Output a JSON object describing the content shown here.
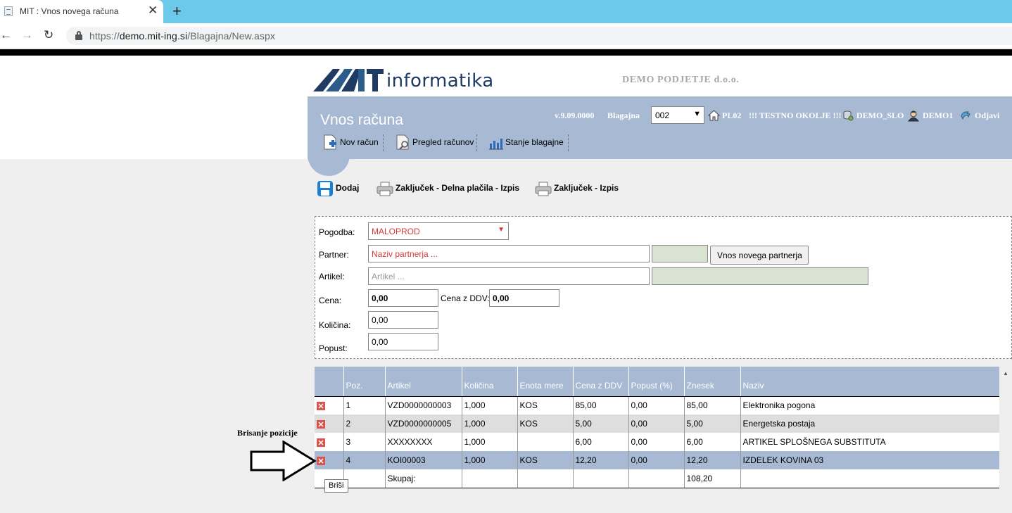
{
  "browser": {
    "tab_title": "MIT : Vnos novega računa",
    "close_glyph": "✕",
    "newtab_glyph": "+",
    "url_scheme": "https://",
    "url_host": "demo.mit-ing.si",
    "url_path": "/Blagajna/New.aspx"
  },
  "header": {
    "logo_text": "informatika",
    "company": "DEMO PODJETJE d.o.o.",
    "page_title": "Vnos računa",
    "version": "v.9.09.0000",
    "blagajna_label": "Blagajna",
    "blagajna_value": "002",
    "location": "PL02",
    "environment": "!!! TESTNO OKOLJE !!!",
    "database": "DEMO_SLO",
    "user": "DEMO1",
    "logout": "Odjavi"
  },
  "menu": {
    "new_invoice": "Nov račun",
    "invoice_list": "Pregled računov",
    "cash_state": "Stanje blagajne"
  },
  "toolbar": {
    "add": "Dodaj",
    "close_partial": "Zaključek - Delna plačila - Izpis",
    "close_print": "Zaključek - Izpis"
  },
  "form": {
    "contract_label": "Pogodba:",
    "contract_value": "MALOPROD",
    "partner_label": "Partner:",
    "partner_placeholder": "Naziv partnerja ...",
    "new_partner_button": "Vnos novega partnerja",
    "item_label": "Artikel:",
    "item_placeholder": "Artikel ...",
    "price_label": "Cena:",
    "price_value": "0,00",
    "price_vat_label": "Cena z DDV:",
    "price_vat_value": "0,00",
    "qty_label": "Količina:",
    "qty_value": "0,00",
    "discount_label": "Popust:",
    "discount_value": "0,00"
  },
  "grid": {
    "headers": [
      "",
      "Poz.",
      "Artikel",
      "Količina",
      "Enota mere",
      "Cena z DDV",
      "Popust (%)",
      "Znesek",
      "Naziv"
    ],
    "rows": [
      {
        "pos": "1",
        "item": "VZD0000000003",
        "qty": "1,000",
        "unit": "KOS",
        "price": "85,00",
        "discount": "0,00",
        "amount": "85,00",
        "name": "Elektronika pogona"
      },
      {
        "pos": "2",
        "item": "VZD0000000005",
        "qty": "1,000",
        "unit": "KOS",
        "price": "5,00",
        "discount": "0,00",
        "amount": "5,00",
        "name": "Energetska postaja"
      },
      {
        "pos": "3",
        "item": "XXXXXXXX",
        "qty": "1,000",
        "unit": "",
        "price": "6,00",
        "discount": "0,00",
        "amount": "6,00",
        "name": "ARTIKEL SPLOŠNEGA SUBSTITUTA"
      },
      {
        "pos": "4",
        "item": "KOI00003",
        "qty": "1,000",
        "unit": "KOS",
        "price": "12,20",
        "discount": "0,00",
        "amount": "12,20",
        "name": "IZDELEK KOVINA 03"
      }
    ],
    "total_label": "Skupaj:",
    "total_value": "108,20"
  },
  "annotation": {
    "label": "Brisanje pozicije",
    "tooltip": "Briši"
  },
  "colors": {
    "header_panel": "#a8bad3",
    "tab_bar": "#6dc9ea",
    "placeholder_red": "#d63a3a",
    "readonly_green": "#d9e3d1"
  }
}
